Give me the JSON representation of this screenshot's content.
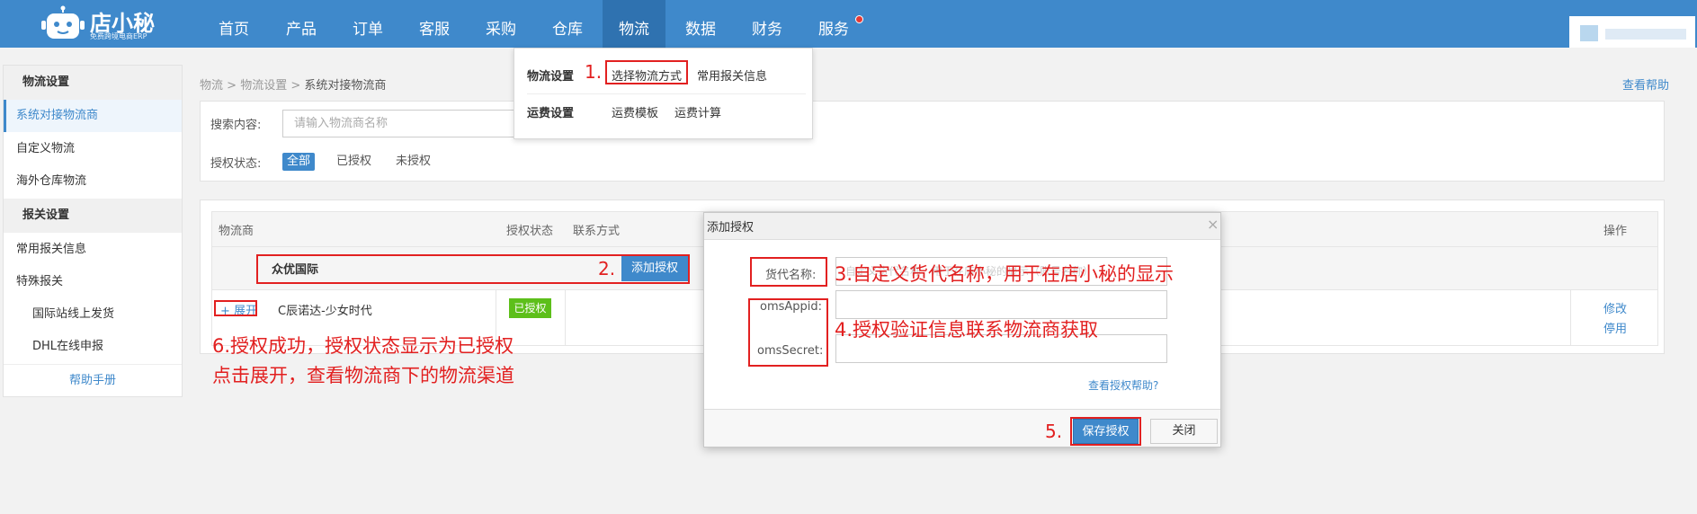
{
  "brand": {
    "name": "店小秘",
    "tagline": "免费跨境电商ERP"
  },
  "nav": {
    "items": [
      "首页",
      "产品",
      "订单",
      "客服",
      "采购",
      "仓库",
      "物流",
      "数据",
      "财务",
      "服务"
    ],
    "active": "物流"
  },
  "dropdown": {
    "group1_title": "物流设置",
    "group1_items": [
      "选择物流方式",
      "常用报关信息"
    ],
    "group2_title": "运费设置",
    "group2_items": [
      "运费模板",
      "运费计算"
    ]
  },
  "sidebar": {
    "section1": "物流设置",
    "items1": [
      "系统对接物流商",
      "自定义物流",
      "海外仓库物流"
    ],
    "section2": "报关设置",
    "items2": [
      "常用报关信息",
      "特殊报关"
    ],
    "sub_items": [
      "国际站线上发货",
      "DHL在线申报"
    ],
    "help": "帮助手册"
  },
  "breadcrumb": {
    "l1": "物流",
    "l2": "物流设置",
    "current": "系统对接物流商",
    "sep": ">"
  },
  "help_link": "查看帮助",
  "search": {
    "label": "搜索内容:",
    "placeholder": "请输入物流商名称",
    "status_label": "授权状态:",
    "filters": [
      "全部",
      "已授权",
      "未授权"
    ]
  },
  "table": {
    "headers": [
      "物流商",
      "授权状态",
      "联系方式",
      "操作"
    ],
    "group_name": "众优国际",
    "add_button": "添加授权",
    "expand": "+ 展开",
    "row_name": "C辰诺达-少女时代",
    "row_status": "已授权",
    "ops": [
      "修改",
      "停用"
    ]
  },
  "dialog": {
    "title": "添加授权",
    "close": "×",
    "field1_label": "货代名称:",
    "field1_placeholder": "自定义货代名称，用于在店小秘的显示（账号名称）",
    "field2_label": "omsAppid:",
    "field3_label": "omsSecret:",
    "help": "查看授权帮助?",
    "save": "保存授权",
    "cancel": "关闭"
  },
  "annotations": {
    "n1": "1.",
    "n2": "2.",
    "n3": "3.自定义货代名称，用于在店小秘的显示",
    "n4": "4.授权验证信息联系物流商获取",
    "n5": "5.",
    "n6_line1": "6.授权成功，授权状态显示为已授权",
    "n6_line2": "点击展开，查看物流商下的物流渠道",
    "color": "#e22020"
  },
  "colors": {
    "primary": "#3f89cb",
    "nav_active": "#2f72b0",
    "authorized": "#5dbf1a"
  }
}
